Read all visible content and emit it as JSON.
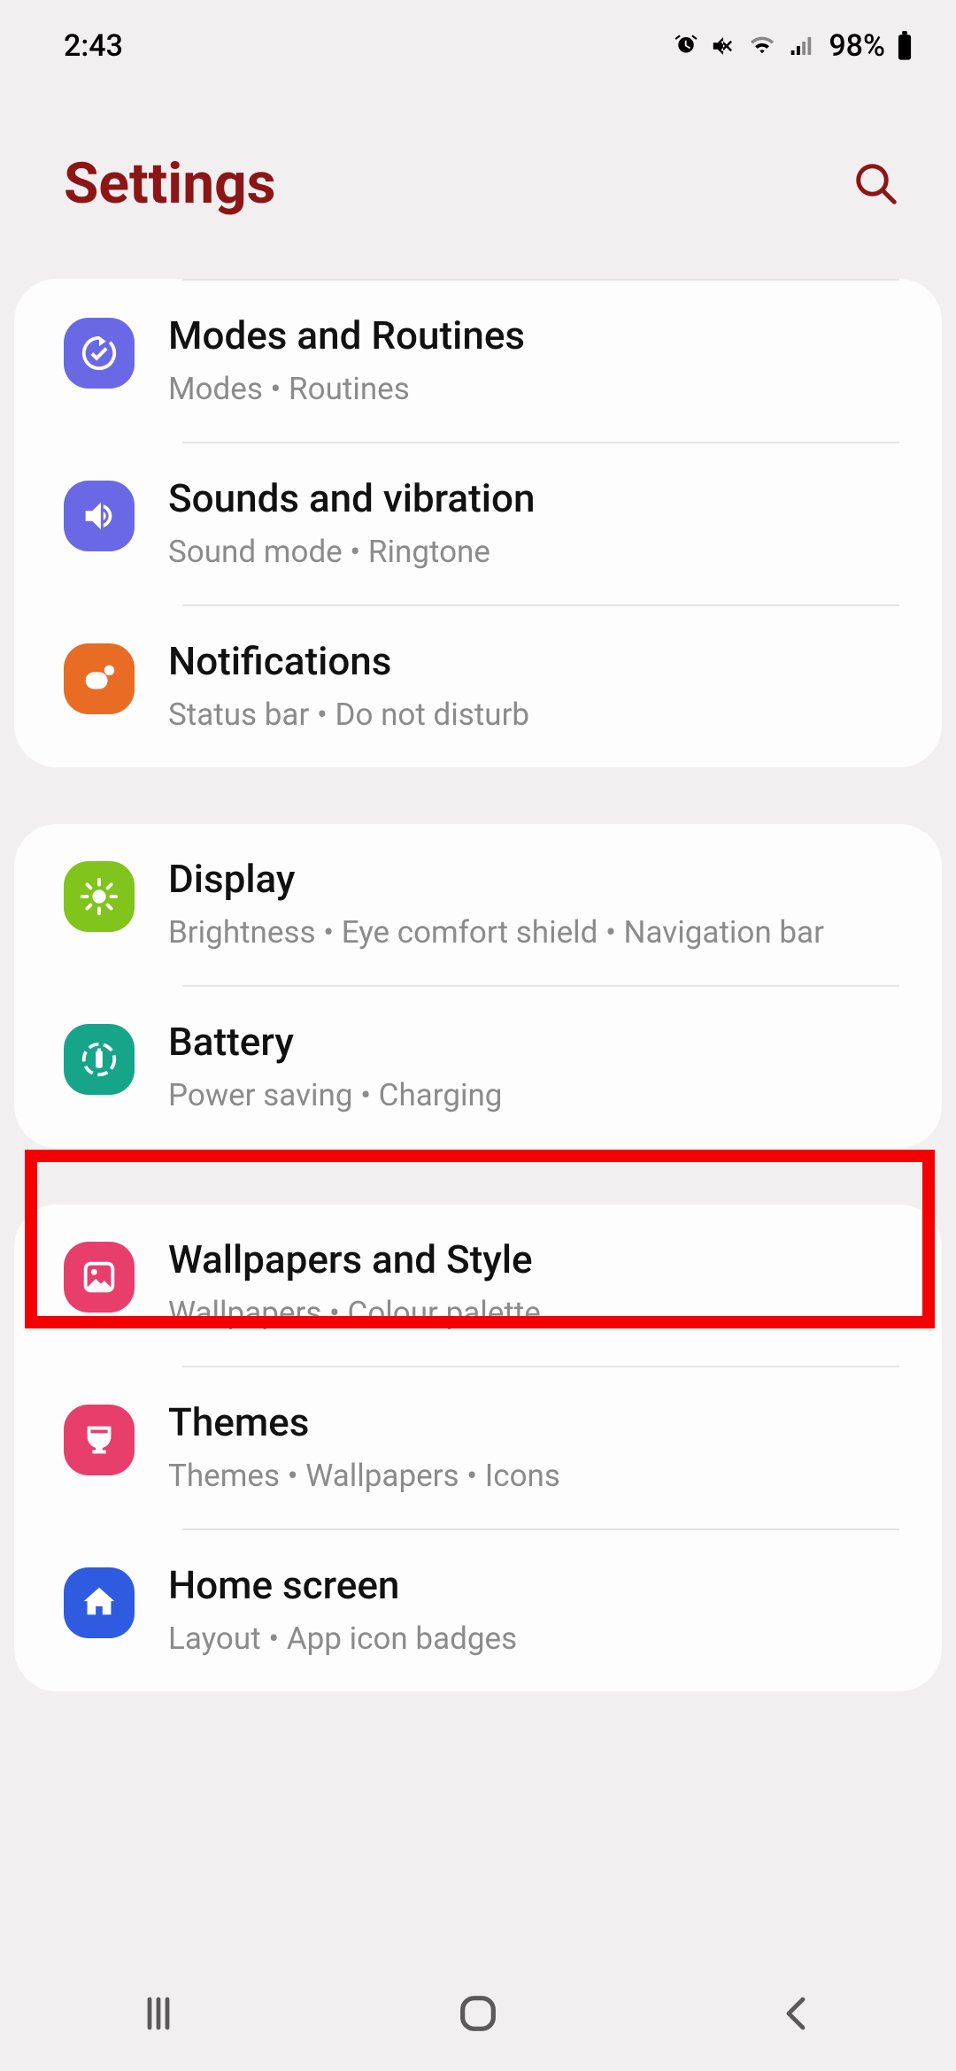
{
  "status_bar": {
    "time": "2:43",
    "battery_pct": "98%"
  },
  "header": {
    "title": "Settings"
  },
  "groups": [
    {
      "items": [
        {
          "key": "modes",
          "title": "Modes and Routines",
          "subtitle": "Modes  •  Routines"
        },
        {
          "key": "sounds",
          "title": "Sounds and vibration",
          "subtitle": "Sound mode  •  Ringtone"
        },
        {
          "key": "notif",
          "title": "Notifications",
          "subtitle": "Status bar  •  Do not disturb"
        }
      ]
    },
    {
      "items": [
        {
          "key": "display",
          "title": "Display",
          "subtitle": "Brightness  •  Eye comfort shield  •  Navigation bar"
        },
        {
          "key": "battery",
          "title": "Battery",
          "subtitle": "Power saving  •  Charging"
        }
      ]
    },
    {
      "items": [
        {
          "key": "wall",
          "title": "Wallpapers and Style",
          "subtitle": "Wallpapers  •  Colour palette"
        },
        {
          "key": "themes",
          "title": "Themes",
          "subtitle": "Themes  •  Wallpapers  •  Icons"
        },
        {
          "key": "home",
          "title": "Home screen",
          "subtitle": "Layout  •  App icon badges"
        }
      ]
    }
  ],
  "highlight": {
    "target": "battery"
  }
}
